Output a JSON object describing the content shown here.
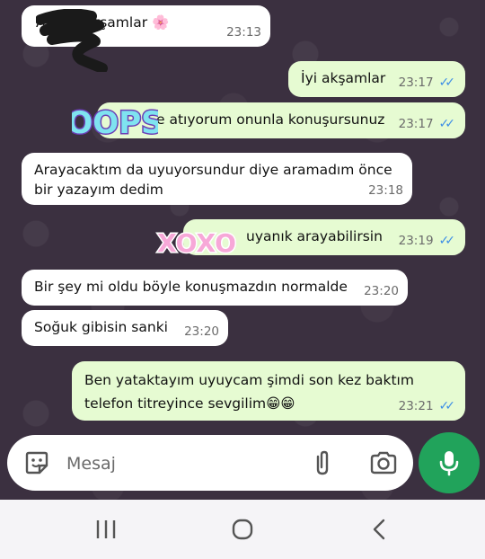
{
  "messages": [
    {
      "dir": "in",
      "text": "A... iyi akşamlar 🌸",
      "time": "23:13"
    },
    {
      "dir": "out",
      "text": "İyi akşamlar",
      "time": "23:17",
      "status": "read"
    },
    {
      "dir": "out",
      "text": "e atıyorum onunla konuşursunuz",
      "time": "23:17",
      "status": "read"
    },
    {
      "dir": "in",
      "text": "Arayacaktım da uyuyorsundur diye aramadım önce\nbir yazayım dedim",
      "time": "23:18"
    },
    {
      "dir": "out",
      "text": "uyanık arayabilirsin",
      "time": "23:19",
      "status": "read"
    },
    {
      "dir": "in",
      "text": "Bir şey mi oldu böyle konuşmazdın normalde",
      "time": "23:20"
    },
    {
      "dir": "in",
      "text": "Soğuk gibisin sanki",
      "time": "23:20"
    },
    {
      "dir": "out",
      "text": "Ben yataktayım uyuycam şimdi son kez baktım\ntelefon titreyince sevgilim😁😁",
      "time": "23:21",
      "status": "read"
    }
  ],
  "stickers": {
    "oops": "OOPS",
    "xoxo": "XOXO"
  },
  "composer": {
    "placeholder": "Mesaj"
  },
  "icons": {
    "emoji": "sticker-smiley-icon",
    "attach": "paperclip-icon",
    "camera": "camera-icon",
    "mic": "microphone-icon",
    "nav_recent": "recent-apps-icon",
    "nav_home": "home-icon",
    "nav_back": "back-icon"
  },
  "colors": {
    "chat_bg": "#3b3040",
    "incoming_bubble": "#ffffff",
    "outgoing_bubble": "#e6fbd2",
    "read_ticks": "#3d8ee6",
    "mic_button": "#21a35b",
    "navbar": "#f5f4f7"
  }
}
